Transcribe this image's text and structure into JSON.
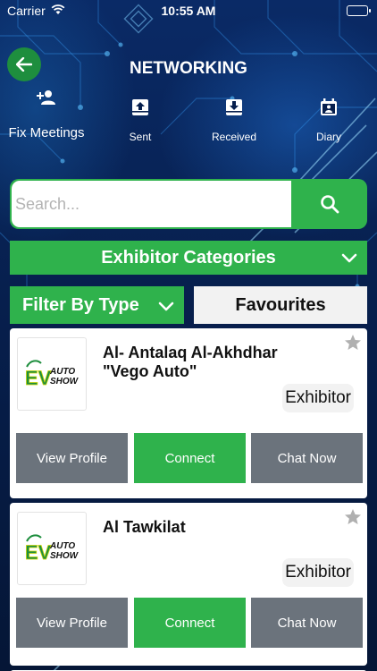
{
  "status_bar": {
    "carrier": "Carrier",
    "time": "10:55 AM"
  },
  "header": {
    "title": "NETWORKING"
  },
  "nav": [
    {
      "label": "Fix Meetings",
      "icon": "add-person-icon"
    },
    {
      "label": "Sent",
      "icon": "upload-box-icon"
    },
    {
      "label": "Received",
      "icon": "download-box-icon"
    },
    {
      "label": "Diary",
      "icon": "calendar-person-icon"
    }
  ],
  "search": {
    "placeholder": "Search...",
    "value": ""
  },
  "filters": {
    "categories_label": "Exhibitor Categories",
    "type_label": "Filter By Type",
    "favourites_label": "Favourites"
  },
  "exhibitors": [
    {
      "name_line1": "Al- Antalaq Al-Akhdhar",
      "name_line2": "\"Vego Auto\"",
      "badge": "Exhibitor",
      "logo_text_1": "EV",
      "logo_text_2": "AUTO",
      "logo_text_3": "SHOW",
      "view_label": "View Profile",
      "connect_label": "Connect",
      "chat_label": "Chat Now"
    },
    {
      "name_line1": "Al Tawkilat",
      "name_line2": "",
      "badge": "Exhibitor",
      "logo_text_1": "EV",
      "logo_text_2": "AUTO",
      "logo_text_3": "SHOW",
      "view_label": "View Profile",
      "connect_label": "Connect",
      "chat_label": "Chat Now"
    }
  ],
  "colors": {
    "accent": "#2fb24c",
    "secondary_button": "#6b737c",
    "background": "#071f4d"
  }
}
